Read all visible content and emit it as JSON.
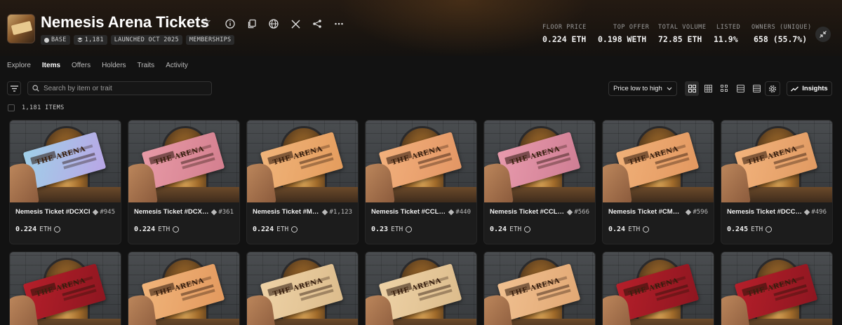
{
  "collection": {
    "title": "Nemesis Arena Tickets",
    "chips": [
      {
        "icon": "base-chain-icon",
        "label": "BASE"
      },
      {
        "icon": "items-stack-icon",
        "label": "1,181"
      },
      {
        "icon": "",
        "label": "LAUNCHED OCT 2025"
      },
      {
        "icon": "",
        "label": "MEMBERSHIPS"
      }
    ]
  },
  "stats": [
    {
      "label": "FLOOR PRICE",
      "value": "0.224 ETH"
    },
    {
      "label": "TOP OFFER",
      "value": "0.198 WETH"
    },
    {
      "label": "TOTAL VOLUME",
      "value": "72.85 ETH"
    },
    {
      "label": "LISTED",
      "value": "11.9%"
    },
    {
      "label": "OWNERS (UNIQUE)",
      "value": "658 (55.7%)"
    }
  ],
  "tabs": [
    "Explore",
    "Items",
    "Offers",
    "Holders",
    "Traits",
    "Activity"
  ],
  "active_tab": "Items",
  "search": {
    "placeholder": "Search by item or trait"
  },
  "sort": {
    "label": "Price low to high"
  },
  "insights_label": "Insights",
  "items_count": "1,181 ITEMS",
  "items": [
    {
      "name": "Nemesis Ticket #DCXCI",
      "rank": "#945",
      "price": "0.224",
      "unit": "ETH",
      "color": "#9fd0e8",
      "color2": "#b9a6e6"
    },
    {
      "name": "Nemesis Ticket #DCX…",
      "rank": "#361",
      "price": "0.224",
      "unit": "ETH",
      "color": "#e79aa6",
      "color2": "#d47f8f"
    },
    {
      "name": "Nemesis Ticket #M…",
      "rank": "#1,123",
      "price": "0.224",
      "unit": "ETH",
      "color": "#f0b47a",
      "color2": "#e49c5d"
    },
    {
      "name": "Nemesis Ticket #CCL…",
      "rank": "#440",
      "price": "0.23",
      "unit": "ETH",
      "color": "#f2b07c",
      "color2": "#e39664"
    },
    {
      "name": "Nemesis Ticket #CCL…",
      "rank": "#566",
      "price": "0.24",
      "unit": "ETH",
      "color": "#e89aac",
      "color2": "#cf7e94"
    },
    {
      "name": "Nemesis Ticket #CM…",
      "rank": "#596",
      "price": "0.24",
      "unit": "ETH",
      "color": "#f0b078",
      "color2": "#e39860"
    },
    {
      "name": "Nemesis Ticket #DCC…",
      "rank": "#496",
      "price": "0.245",
      "unit": "ETH",
      "color": "#f2b37c",
      "color2": "#e19a62"
    }
  ],
  "items_row2": [
    {
      "color": "#b51f2a",
      "color2": "#8e1620"
    },
    {
      "color": "#f0b47a",
      "color2": "#e3995e"
    },
    {
      "color": "#eed2a6",
      "color2": "#dcbc8c"
    },
    {
      "color": "#eed2a6",
      "color2": "#dcbc8c"
    },
    {
      "color": "#f0c090",
      "color2": "#e2a874"
    },
    {
      "color": "#b51f2a",
      "color2": "#8e1620"
    },
    {
      "color": "#b51f2a",
      "color2": "#8e1620"
    }
  ],
  "ticket_label": "THE ARENA"
}
